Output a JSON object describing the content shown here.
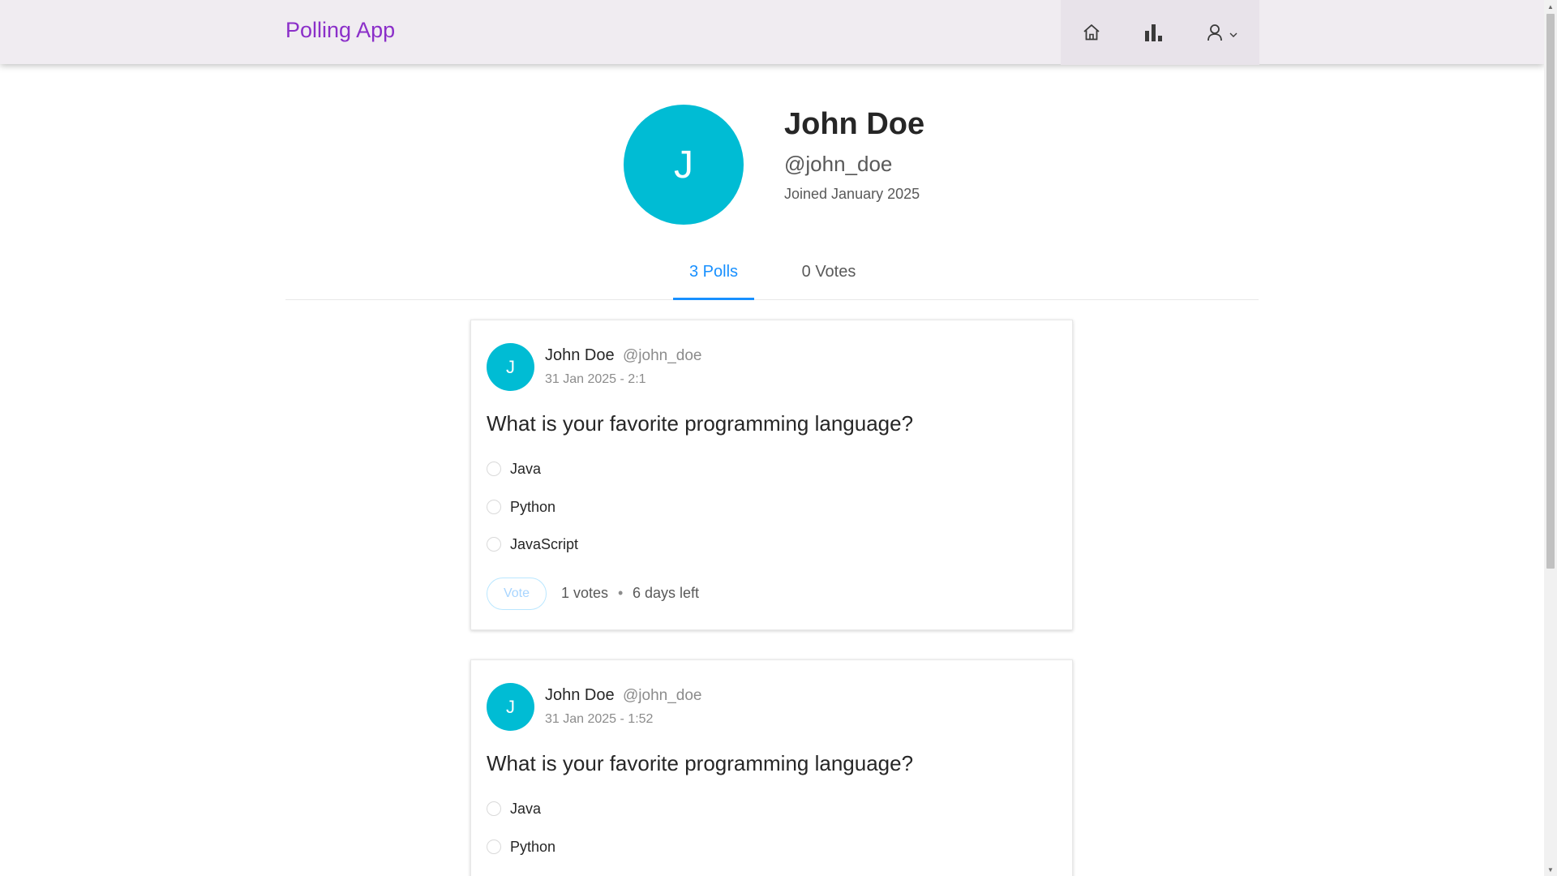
{
  "header": {
    "brand": "Polling App",
    "nav": {
      "home_icon": "home-icon",
      "polls_icon": "bar-chart-icon",
      "user_icon": "user-icon",
      "dropdown_icon": "chevron-down-icon"
    },
    "background": "#f0ecf1",
    "brand_color": "#8b2fc9"
  },
  "profile": {
    "avatar_letter": "J",
    "name": "John Doe",
    "username": "@john_doe",
    "joined": "Joined January 2025",
    "avatar_color": "#00bcd4"
  },
  "tabs": [
    {
      "label": "3 Polls",
      "active": true
    },
    {
      "label": "0 Votes",
      "active": false
    }
  ],
  "accent_color": "#1890ff",
  "polls": [
    {
      "avatar_letter": "J",
      "creator_name": "John Doe",
      "creator_username": "@john_doe",
      "time": "31 Jan 2025 - 2:1",
      "question": "What is your favorite programming language?",
      "choices": [
        "Java",
        "Python",
        "JavaScript"
      ],
      "vote_label": "Vote",
      "votes": "1 votes",
      "separator": "•",
      "time_left": "6 days left"
    },
    {
      "avatar_letter": "J",
      "creator_name": "John Doe",
      "creator_username": "@john_doe",
      "time": "31 Jan 2025 - 1:52",
      "question": "What is your favorite programming language?",
      "choices": [
        "Java",
        "Python"
      ]
    }
  ]
}
